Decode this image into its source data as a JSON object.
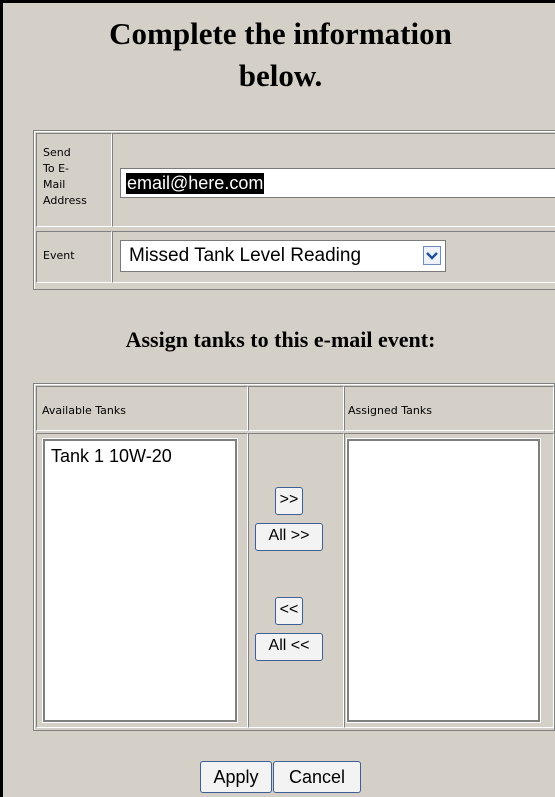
{
  "page": {
    "heading": "Complete the information below.",
    "heading_line1": "Complete the information",
    "heading_line2": "below."
  },
  "form": {
    "email_label_lines": [
      "Send",
      "To E-",
      "Mail",
      "Address"
    ],
    "email_value": "email@here.com",
    "event_label": "Event",
    "event_selected": "Missed Tank Level Reading",
    "dropdown_icon": "chevron-down-icon"
  },
  "assign": {
    "title": "Assign tanks to this e-mail event:",
    "available_header": "Available Tanks",
    "assigned_header": "Assigned Tanks",
    "available_items": [
      "Tank 1 10W-20"
    ],
    "assigned_items": []
  },
  "buttons": {
    "move_right": ">>",
    "move_all_right": "All >>",
    "move_left": "<<",
    "move_all_left": "All <<",
    "apply": "Apply",
    "cancel": "Cancel"
  },
  "colors": {
    "panel": "#d4d0c8",
    "selection": "#000000",
    "button_border": "#3d5f96"
  }
}
